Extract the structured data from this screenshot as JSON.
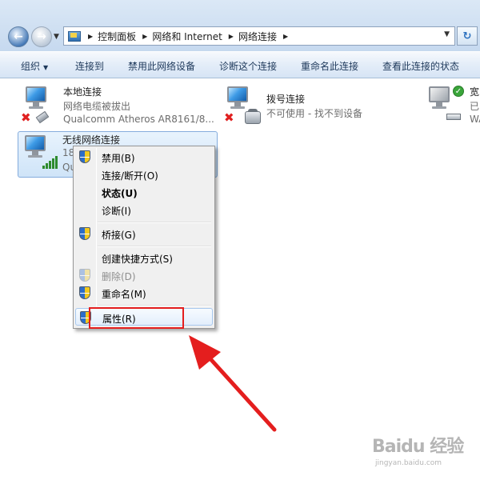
{
  "address_bar": {
    "breadcrumbs": [
      "控制面板",
      "网络和 Internet",
      "网络连接"
    ]
  },
  "toolbar": {
    "organize": "组织",
    "connect_to": "连接到",
    "disable_device": "禁用此网络设备",
    "diagnose": "诊断这个连接",
    "rename": "重命名此连接",
    "view_status": "查看此连接的状态"
  },
  "connections": [
    {
      "name": "本地连接",
      "status": "网络电缆被拔出",
      "device": "Qualcomm Atheros AR8161/8..."
    },
    {
      "name": "拨号连接",
      "status": "不可使用 - 找不到设备",
      "device": ""
    },
    {
      "name": "宽",
      "status": "已",
      "device": "WA"
    },
    {
      "name": "无线网络连接",
      "status": "18",
      "device": "Qu"
    }
  ],
  "context_menu": {
    "items": [
      {
        "label": "禁用(B)",
        "shield": true,
        "bold": false,
        "disabled": false
      },
      {
        "label": "连接/断开(O)",
        "shield": false,
        "bold": false,
        "disabled": false
      },
      {
        "label": "状态(U)",
        "shield": false,
        "bold": true,
        "disabled": false
      },
      {
        "label": "诊断(I)",
        "shield": false,
        "bold": false,
        "disabled": false
      },
      {
        "label": "桥接(G)",
        "shield": true,
        "bold": false,
        "disabled": false
      },
      {
        "label": "创建快捷方式(S)",
        "shield": false,
        "bold": false,
        "disabled": false
      },
      {
        "label": "删除(D)",
        "shield": true,
        "bold": false,
        "disabled": true
      },
      {
        "label": "重命名(M)",
        "shield": true,
        "bold": false,
        "disabled": false
      },
      {
        "label": "属性(R)",
        "shield": true,
        "bold": false,
        "disabled": false,
        "hovered": true
      }
    ]
  },
  "colors": {
    "highlight": "#e41e1e",
    "arrow": "#e41e1e"
  },
  "watermark": {
    "main": "Baidu 经验",
    "sub": "jingyan.baidu.com"
  }
}
